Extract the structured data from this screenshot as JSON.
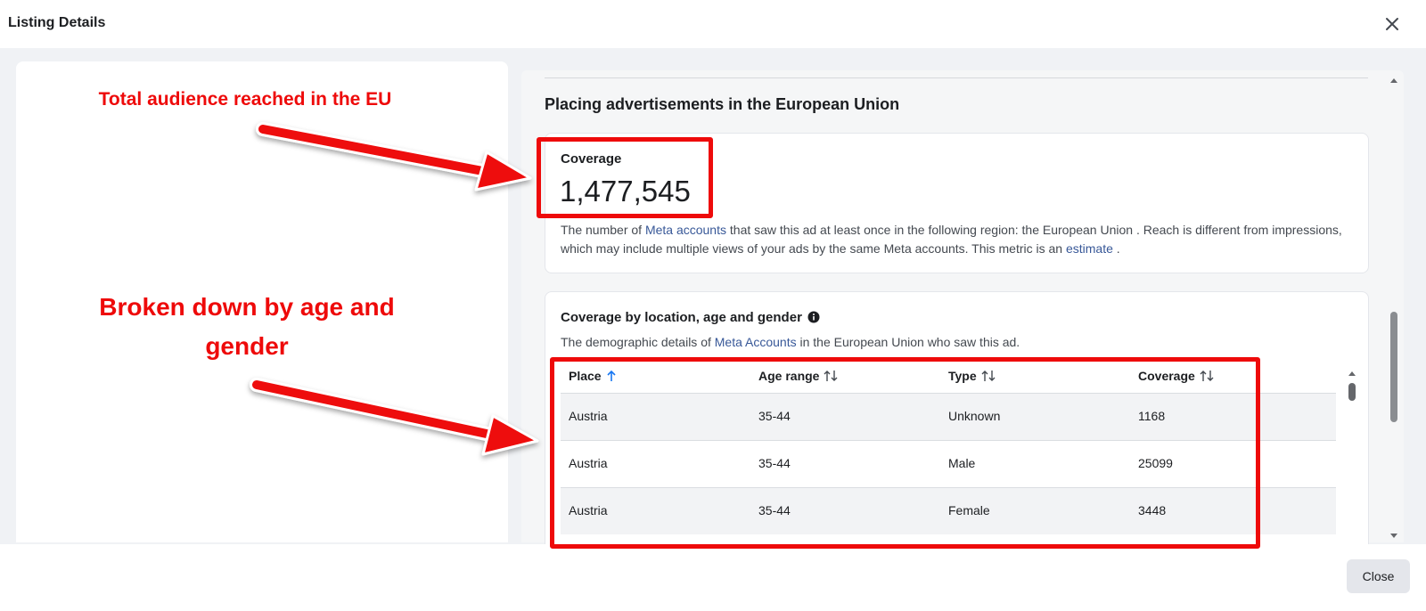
{
  "dialog": {
    "title": "Listing Details",
    "close_label": "Close",
    "close_icon": "close-x-icon"
  },
  "section": {
    "title": "Placing advertisements in the European Union"
  },
  "coverage": {
    "label": "Coverage",
    "value": "1,477,545",
    "desc_pre": "The number of ",
    "desc_link1": "Meta accounts",
    "desc_mid": " that saw this ad at least once in the following region: the European Union . Reach is different from impressions, which may include multiple views of your ads by the same Meta accounts. This metric is an ",
    "desc_link2": "estimate",
    "desc_post": " ."
  },
  "demographics": {
    "title": "Coverage by location, age and gender",
    "info_icon": "info-icon",
    "desc_pre": "The demographic details of ",
    "desc_link": "Meta Accounts",
    "desc_post": " in the European Union who saw this ad.",
    "columns": [
      "Place",
      "Age range",
      "Type",
      "Coverage"
    ],
    "rows": [
      [
        "Austria",
        "35-44",
        "Unknown",
        "1168"
      ],
      [
        "Austria",
        "35-44",
        "Male",
        "25099"
      ],
      [
        "Austria",
        "35-44",
        "Female",
        "3448"
      ]
    ]
  },
  "annotations": {
    "top": "Total audience reached in the EU",
    "bottom_line1": "Broken down by age and",
    "bottom_line2": "gender",
    "color": "#ee0a0a"
  },
  "colors": {
    "link": "#385898",
    "sort_active": "#1877f2",
    "backdrop": "#f0f2f5"
  }
}
